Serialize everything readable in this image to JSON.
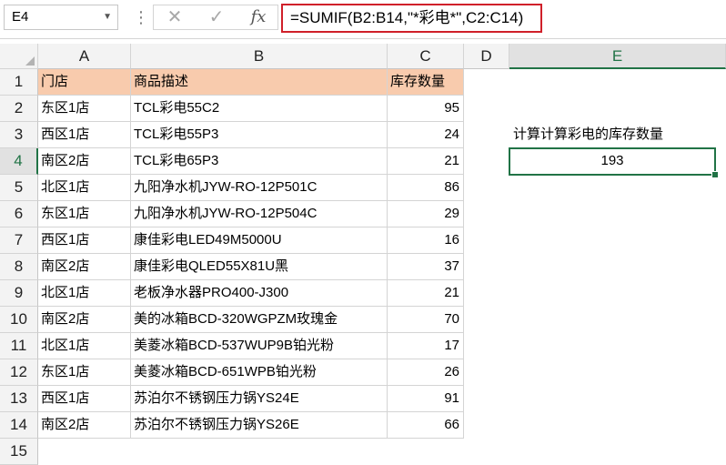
{
  "formula_bar": {
    "name_box": "E4",
    "cancel_icon": "✕",
    "enter_icon": "✓",
    "fx_label": "fx",
    "formula": "=SUMIF(B2:B14,\"*彩电*\",C2:C14)"
  },
  "columns": [
    "A",
    "B",
    "C",
    "D",
    "E"
  ],
  "selected_column": "E",
  "rows": [
    "1",
    "2",
    "3",
    "4",
    "5",
    "6",
    "7",
    "8",
    "9",
    "10",
    "11",
    "12",
    "13",
    "14",
    "15"
  ],
  "selected_row": "4",
  "table": {
    "headers": [
      "门店",
      "商品描述",
      "库存数量"
    ],
    "header_fill": "#F8CBAD",
    "data": [
      [
        "东区1店",
        "TCL彩电55C2",
        "95"
      ],
      [
        "西区1店",
        "TCL彩电55P3",
        "24"
      ],
      [
        "南区2店",
        "TCL彩电65P3",
        "21"
      ],
      [
        "北区1店",
        "九阳净水机JYW-RO-12P501C",
        "86"
      ],
      [
        "东区1店",
        "九阳净水机JYW-RO-12P504C",
        "29"
      ],
      [
        "西区1店",
        "康佳彩电LED49M5000U",
        "16"
      ],
      [
        "南区2店",
        "康佳彩电QLED55X81U黑",
        "37"
      ],
      [
        "北区1店",
        "老板净水器PRO400-J300",
        "21"
      ],
      [
        "南区2店",
        "美的冰箱BCD-320WGPZM玫瑰金",
        "70"
      ],
      [
        "北区1店",
        "美菱冰箱BCD-537WUP9B铂光粉",
        "17"
      ],
      [
        "东区1店",
        "美菱冰箱BCD-651WPB铂光粉",
        "26"
      ],
      [
        "西区1店",
        "苏泊尔不锈钢压力锅YS24E",
        "91"
      ],
      [
        "南区2店",
        "苏泊尔不锈钢压力锅YS26E",
        "66"
      ]
    ]
  },
  "side": {
    "label": "计算计算彩电的库存数量",
    "result": "193"
  },
  "colors": {
    "accent": "#217346",
    "formula_border": "#D0202A"
  }
}
